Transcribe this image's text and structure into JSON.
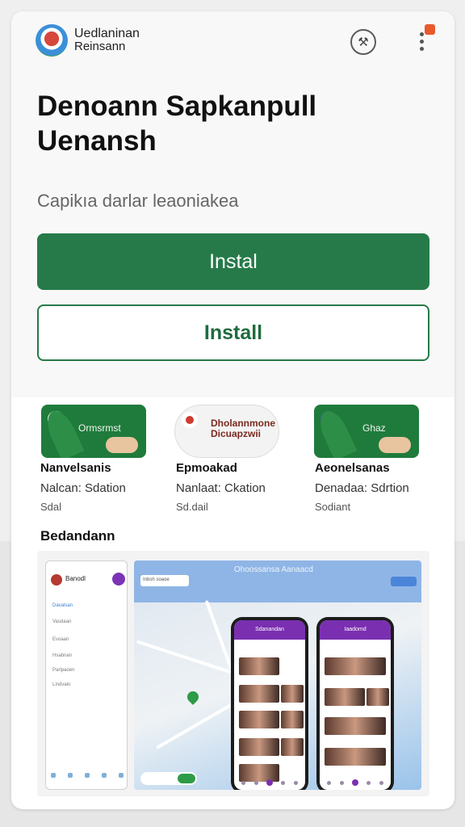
{
  "header": {
    "app_name": "Uedlaninan",
    "app_sub": "Reinsann",
    "icons": [
      "app-logo-icon",
      "account-icon",
      "more-vert-icon"
    ]
  },
  "hero": {
    "title": "Denoann Sapkanpull Uenansh",
    "subtitle": "Capikıa darlar leaoniakea"
  },
  "buttons": {
    "primary": "Instal",
    "secondary": "Install"
  },
  "apps": [
    {
      "tile_text": "Ormsrmst",
      "name": "Nanvelsanis",
      "line": "Nalcan: Sdation",
      "cat": "Sdal"
    },
    {
      "tile_text": "Dholannmone Dicuapzwii",
      "name": "Epmoakad",
      "line": "Nanlaat: Ckation",
      "cat": "Sd.dail"
    },
    {
      "tile_text": "Ghaz",
      "name": "Aeonelsanas",
      "line": "Denadaa: Sdrtion",
      "cat": "Sodiant"
    }
  ],
  "section": {
    "title": "Bedandann"
  },
  "gallery": {
    "side_title": "Banodl",
    "side_rows": [
      "Davalsan",
      "Vasdaan",
      "Evoaan",
      "Hsabnan",
      "Parlpaoen",
      "Lindvalo"
    ],
    "map_title": "Ohoossansa Aanaacd",
    "map_search": "Inbsh soaoe",
    "phone_left_title": "Sdanandan",
    "phone_right_title": "Iaadomd"
  },
  "colors": {
    "accent": "#267a49",
    "purple": "#7a2fb0",
    "notif": "#e85a2c"
  }
}
